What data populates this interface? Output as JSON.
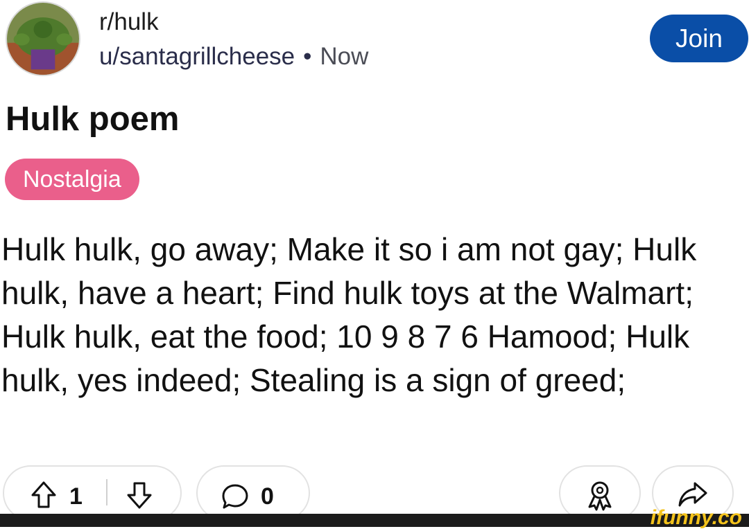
{
  "post": {
    "subreddit": "r/hulk",
    "author": "u/santagrillcheese",
    "separator": "•",
    "time": "Now",
    "join_label": "Join",
    "title": "Hulk poem",
    "flair": "Nostalgia",
    "body": "Hulk hulk, go away; Make it so i am not gay; Hulk hulk, have a heart; Find hulk toys at the Walmart; Hulk hulk, eat the food; 10 9 8 7 6 Hamood; Hulk hulk, yes indeed; Stealing is a sign of greed;"
  },
  "actions": {
    "upvotes": "1",
    "comments": "0"
  },
  "icons": {
    "upvote": "upvote-arrow-icon",
    "downvote": "downvote-arrow-icon",
    "comment": "comment-bubble-icon",
    "award": "award-icon",
    "share": "share-arrow-icon"
  },
  "colors": {
    "join_button": "#0a4ea7",
    "flair": "#ea5f8b",
    "watermark": "#f3c21b"
  },
  "watermark": "ifunny.co"
}
